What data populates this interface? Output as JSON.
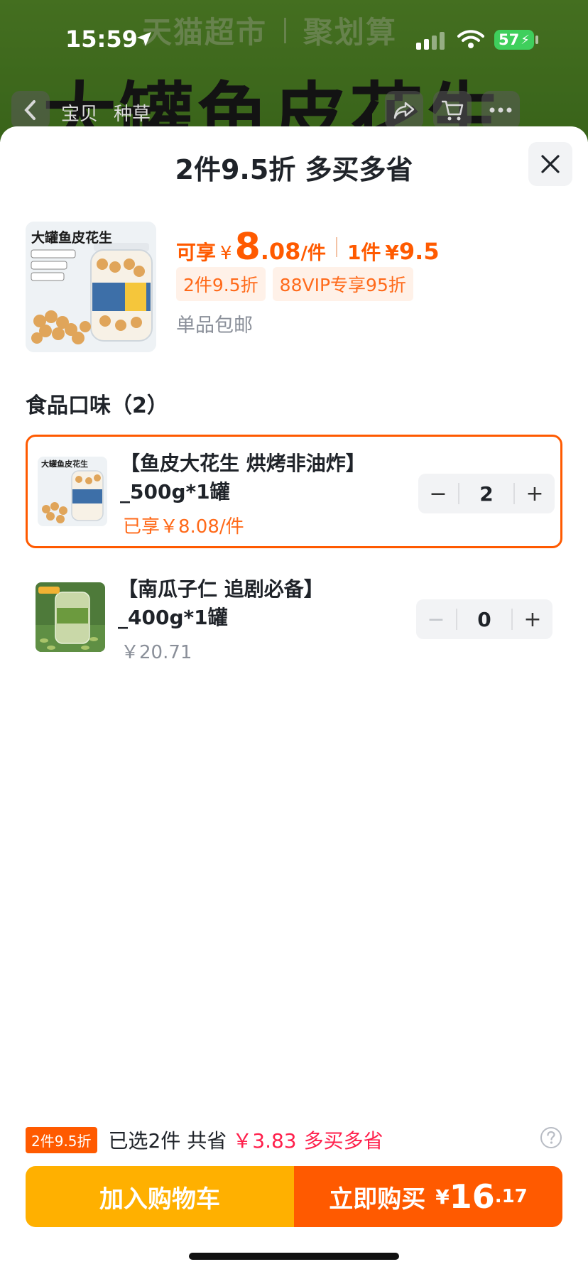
{
  "status_bar": {
    "time": "15:59",
    "battery": "57"
  },
  "background": {
    "banner_left": "天猫超市",
    "banner_right": "聚划算",
    "big_title": "大罐鱼皮花生",
    "nav_tabs": [
      "宝贝",
      "种草"
    ]
  },
  "sheet": {
    "title": "2件9.5折 多买多省",
    "product": {
      "image_title": "大罐鱼皮花生",
      "price_label": "可享",
      "currency": "¥",
      "price_int": "8",
      "price_dec": ".08",
      "price_unit": "/件",
      "single_label": "1件",
      "single_price": "9.5",
      "tags": [
        "2件9.5折",
        "88VIP专享95折"
      ],
      "shipping": "单品包邮"
    },
    "section_title": "食品口味（2）",
    "skus": [
      {
        "name_line1": "【鱼皮大花生 烘烤非油炸】",
        "name_line2": "_500g*1罐",
        "price": "已享￥8.08/件",
        "qty": "2",
        "minus": "−",
        "plus": "+"
      },
      {
        "name_line1": "【南瓜子仁 追剧必备】",
        "name_line2": "_400g*1罐",
        "price": "￥20.71",
        "qty": "0",
        "minus": "−",
        "plus": "+"
      }
    ],
    "summary": {
      "badge": "2件9.5折",
      "selected_text": "已选2件 共省",
      "saved": "￥3.83",
      "more": "多买多省"
    },
    "buttons": {
      "add_cart": "加入购物车",
      "buy_now": "立即购买",
      "buy_yen": "¥",
      "buy_int": "16",
      "buy_dec": ".17"
    }
  },
  "colors": {
    "accent": "#ff5a00",
    "cart_button": "#ffb000",
    "saving_red": "#ff1f4b"
  },
  "icons": [
    "location-arrow-icon",
    "signal-icon",
    "wifi-icon",
    "battery-icon",
    "back-icon",
    "share-icon",
    "cart-icon",
    "more-icon",
    "close-icon",
    "help-icon"
  ]
}
